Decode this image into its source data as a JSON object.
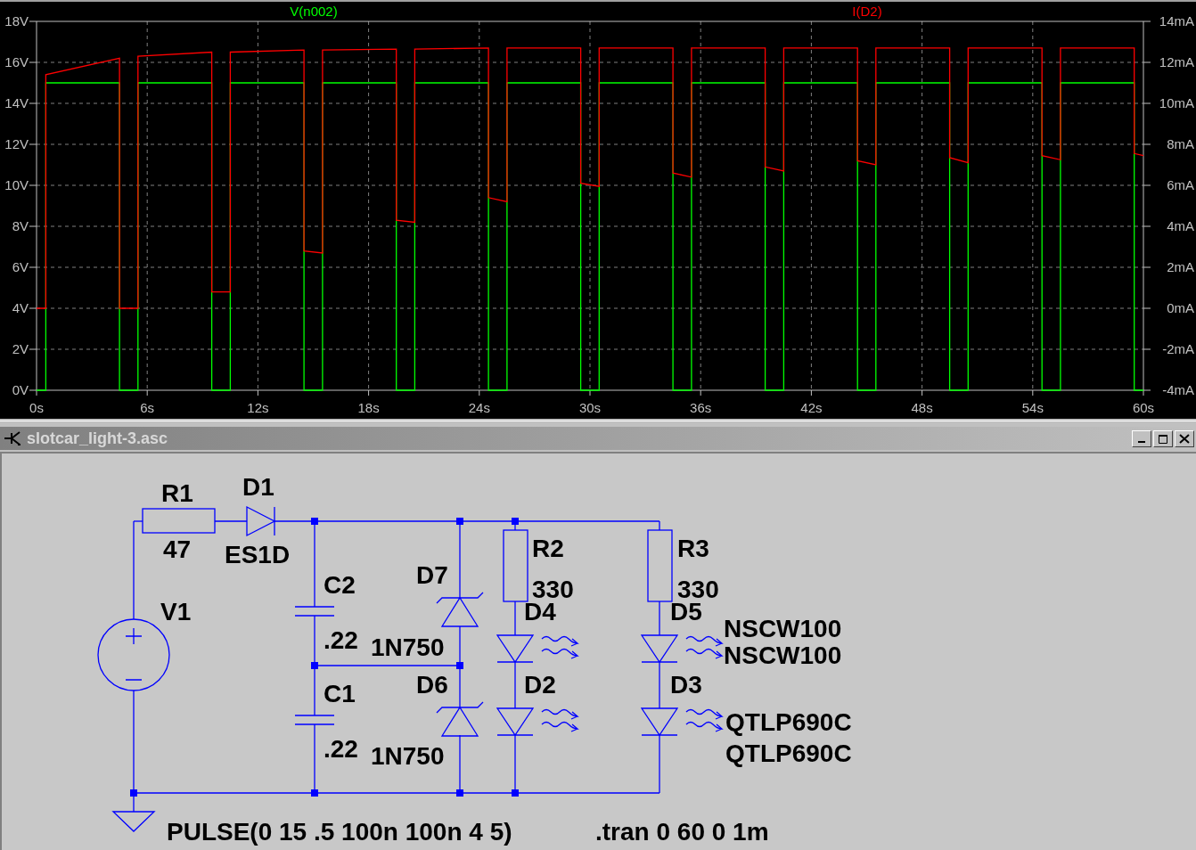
{
  "plot": {
    "chart_data": {
      "type": "line",
      "x": [
        0,
        0.5,
        0.5,
        4.5,
        4.5,
        5.5,
        5.5,
        9.5,
        9.5,
        10.5,
        10.5,
        14.5,
        14.5,
        15.5,
        15.5,
        19.5,
        19.5,
        20.5,
        20.5,
        24.5,
        24.5,
        25.5,
        25.5,
        29.5,
        29.5,
        30.5,
        30.5,
        34.5,
        34.5,
        35.5,
        35.5,
        39.5,
        39.5,
        40.5,
        40.5,
        44.5,
        44.5,
        45.5,
        45.5,
        49.5,
        49.5,
        50.5,
        50.5,
        54.5,
        54.5,
        55.5,
        55.5,
        59.5,
        59.5,
        60
      ],
      "series": [
        {
          "name": "V(n002)",
          "color": "#00ff00",
          "axis": "y",
          "values": [
            0,
            0,
            15,
            15,
            0,
            0,
            15,
            15,
            0,
            0,
            15,
            15,
            0,
            0,
            15,
            15,
            0,
            0,
            15,
            15,
            0,
            0,
            15,
            15,
            0,
            0,
            15,
            15,
            0,
            0,
            15,
            15,
            0,
            0,
            15,
            15,
            0,
            0,
            15,
            15,
            0,
            0,
            15,
            15,
            0,
            0,
            15,
            15,
            0,
            0
          ]
        },
        {
          "name": "I(D2)",
          "color": "#ff0000",
          "axis": "y2",
          "values": [
            0,
            0,
            11.4,
            12.2,
            0,
            0,
            12.3,
            12.5,
            0.8,
            0.8,
            12.5,
            12.6,
            2.8,
            2.7,
            12.6,
            12.65,
            4.3,
            4.2,
            12.65,
            12.7,
            5.4,
            5.2,
            12.7,
            12.7,
            6.1,
            5.95,
            12.7,
            12.7,
            6.6,
            6.4,
            12.7,
            12.7,
            6.9,
            6.7,
            12.7,
            12.7,
            7.2,
            7.0,
            12.7,
            12.7,
            7.35,
            7.1,
            12.7,
            12.7,
            7.45,
            7.25,
            12.7,
            12.7,
            7.55,
            7.45
          ]
        }
      ],
      "grid": true,
      "xlim": [
        0,
        60
      ],
      "ylim": [
        0,
        18
      ],
      "y2lim": [
        -4,
        14
      ],
      "xticks": [
        {
          "value": 0,
          "label": "0s"
        },
        {
          "value": 6,
          "label": "6s"
        },
        {
          "value": 12,
          "label": "12s"
        },
        {
          "value": 18,
          "label": "18s"
        },
        {
          "value": 24,
          "label": "24s"
        },
        {
          "value": 30,
          "label": "30s"
        },
        {
          "value": 36,
          "label": "36s"
        },
        {
          "value": 42,
          "label": "42s"
        },
        {
          "value": 48,
          "label": "48s"
        },
        {
          "value": 54,
          "label": "54s"
        },
        {
          "value": 60,
          "label": "60s"
        }
      ],
      "yticks": [
        {
          "value": 0,
          "label": "0V"
        },
        {
          "value": 2,
          "label": "2V"
        },
        {
          "value": 4,
          "label": "4V"
        },
        {
          "value": 6,
          "label": "6V"
        },
        {
          "value": 8,
          "label": "8V"
        },
        {
          "value": 10,
          "label": "10V"
        },
        {
          "value": 12,
          "label": "12V"
        },
        {
          "value": 14,
          "label": "14V"
        },
        {
          "value": 16,
          "label": "16V"
        },
        {
          "value": 18,
          "label": "18V"
        }
      ],
      "y2ticks": [
        {
          "value": -4,
          "label": "-4mA"
        },
        {
          "value": -2,
          "label": "-2mA"
        },
        {
          "value": 0,
          "label": "0mA"
        },
        {
          "value": 2,
          "label": "2mA"
        },
        {
          "value": 4,
          "label": "4mA"
        },
        {
          "value": 6,
          "label": "6mA"
        },
        {
          "value": 8,
          "label": "8mA"
        },
        {
          "value": 10,
          "label": "10mA"
        },
        {
          "value": 12,
          "label": "12mA"
        },
        {
          "value": 14,
          "label": "14mA"
        }
      ]
    }
  },
  "schematic_window": {
    "title": "slotcar_light-3.asc",
    "components": [
      {
        "kind": "resistor",
        "ref": "R1",
        "value": "47"
      },
      {
        "kind": "diode",
        "ref": "D1",
        "value": "ES1D"
      },
      {
        "kind": "resistor",
        "ref": "R2",
        "value": "330"
      },
      {
        "kind": "resistor",
        "ref": "R3",
        "value": "330"
      },
      {
        "kind": "capacitor",
        "ref": "C2",
        "value": ".22"
      },
      {
        "kind": "zener",
        "ref": "D7",
        "value": "1N750"
      },
      {
        "kind": "voltage_source",
        "ref": "V1",
        "value": "PULSE(0 15 .5 100n 100n 4 5)"
      },
      {
        "kind": "led",
        "ref": "D4",
        "value": "NSCW100"
      },
      {
        "kind": "led",
        "ref": "D5",
        "value": "NSCW100"
      },
      {
        "kind": "capacitor",
        "ref": "C1",
        "value": ".22"
      },
      {
        "kind": "zener",
        "ref": "D6",
        "value": "1N750"
      },
      {
        "kind": "led",
        "ref": "D2",
        "value": "QTLP690C"
      },
      {
        "kind": "led",
        "ref": "D3",
        "value": "QTLP690C"
      }
    ],
    "directives": [
      ".tran 0 60 0 1m"
    ]
  }
}
